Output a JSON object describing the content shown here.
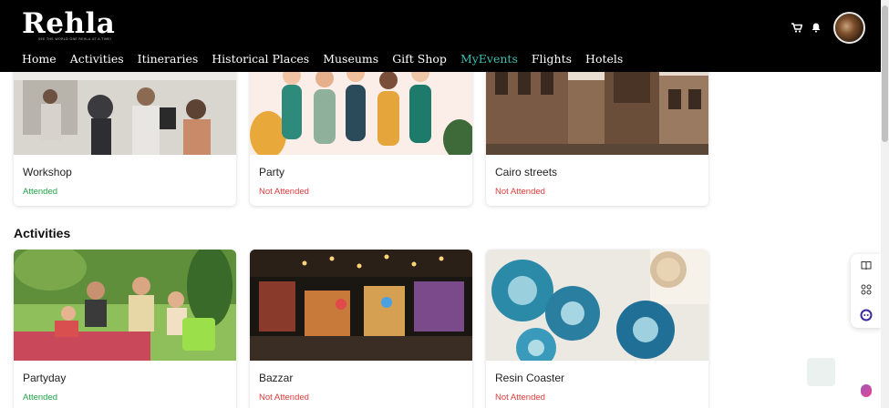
{
  "brand": {
    "name": "Rehla",
    "tagline": "SEE THE WORLD ONE REHLA AT A TIME!"
  },
  "nav": [
    {
      "label": "Home"
    },
    {
      "label": "Activities"
    },
    {
      "label": "Itineraries"
    },
    {
      "label": "Historical Places"
    },
    {
      "label": "Museums"
    },
    {
      "label": "Gift Shop"
    },
    {
      "label": "MyEvents",
      "active": true
    },
    {
      "label": "Flights"
    },
    {
      "label": "Hotels"
    }
  ],
  "header_icons": {
    "cart": "cart-icon",
    "bell": "bell-icon",
    "avatar": "user-avatar"
  },
  "top_events": [
    {
      "title": "Workshop",
      "status": "Attended"
    },
    {
      "title": "Party",
      "status": "Not Attended"
    },
    {
      "title": "Cairo streets",
      "status": "Not Attended"
    }
  ],
  "activities": {
    "heading": "Activities",
    "items": [
      {
        "title": "Partyday",
        "status": "Attended"
      },
      {
        "title": "Bazzar",
        "status": "Not Attended"
      },
      {
        "title": "Resin Coaster",
        "status": "Not Attended"
      }
    ]
  },
  "colors": {
    "header_bg": "#000000",
    "active_nav": "#3fbfb0",
    "attended": "#22a447",
    "not_attended": "#e03b3b"
  },
  "floating_tools": [
    "book-icon",
    "grid-icon",
    "bot-icon"
  ]
}
